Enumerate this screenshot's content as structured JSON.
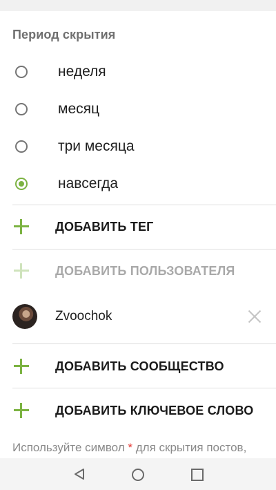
{
  "section_title": "Период скрытия",
  "period_options": [
    {
      "label": "неделя",
      "checked": false
    },
    {
      "label": "месяц",
      "checked": false
    },
    {
      "label": "три месяца",
      "checked": false
    },
    {
      "label": "навсегда",
      "checked": true
    }
  ],
  "actions": {
    "add_tag": "ДОБАВИТЬ ТЕГ",
    "add_user": "ДОБАВИТЬ ПОЛЬЗОВАТЕЛЯ",
    "add_community": "ДОБАВИТЬ СООБЩЕСТВО",
    "add_keyword": "ДОБАВИТЬ КЛЮЧЕВОЕ СЛОВО"
  },
  "user": {
    "name": "Zvoochok"
  },
  "hint": {
    "before": "Используйте символ ",
    "star": "*",
    "after": " для скрытия постов,"
  },
  "colors": {
    "accent": "#7cb342",
    "accent_disabled": "#cfe3bc",
    "hint_star": "#e53935"
  },
  "icons": [
    "plus-icon",
    "close-icon",
    "nav-back-icon",
    "nav-home-icon",
    "nav-recent-icon"
  ]
}
